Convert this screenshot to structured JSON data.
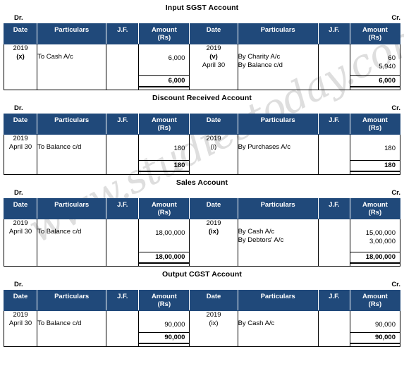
{
  "watermark": {
    "text": "www.studiestoday.com"
  },
  "labels": {
    "dr": "Dr.",
    "cr": "Cr.",
    "col_date": "Date",
    "col_particulars": "Particulars",
    "col_jf": "J.F.",
    "col_amount_line1": "Amount",
    "col_amount_line2": "(Rs)"
  },
  "colors": {
    "header_bg": "#20497a",
    "header_text": "#ffffff",
    "border": "#000000",
    "watermark": "#d9d9d9"
  },
  "accounts": [
    {
      "title": "Input SGST Account",
      "debit": {
        "date_lines": [
          "2019",
          "(x)"
        ],
        "date_bold": [
          false,
          true
        ],
        "particulars": [
          "To Cash A/c"
        ],
        "jf": "",
        "amounts": [
          "6,000"
        ],
        "total": "6,000"
      },
      "credit": {
        "date_lines": [
          "2019",
          "(v)",
          "April 30"
        ],
        "date_bold": [
          false,
          true,
          false
        ],
        "particulars": [
          "By Charity A/c",
          "By Balance c/d"
        ],
        "jf": "",
        "amounts": [
          "60",
          "5,940"
        ],
        "total": "6,000"
      }
    },
    {
      "title": "Discount Received  Account",
      "debit": {
        "date_lines": [
          "2019",
          "April 30"
        ],
        "date_bold": [
          false,
          false
        ],
        "particulars": [
          "To Balance c/d"
        ],
        "jf": "",
        "amounts": [
          "180"
        ],
        "total": "180"
      },
      "credit": {
        "date_lines": [
          "2019",
          "(i)"
        ],
        "date_bold": [
          false,
          false
        ],
        "particulars": [
          "By Purchases A/c"
        ],
        "jf": "",
        "amounts": [
          "180"
        ],
        "total": "180"
      }
    },
    {
      "title": "Sales Account",
      "debit": {
        "date_lines": [
          "2019",
          "April 30"
        ],
        "date_bold": [
          false,
          false
        ],
        "particulars": [
          "To Balance c/d"
        ],
        "jf": "",
        "amounts": [
          "18,00,000"
        ],
        "total": "18,00,000"
      },
      "credit": {
        "date_lines": [
          "2019",
          "(ix)"
        ],
        "date_bold": [
          false,
          true
        ],
        "particulars": [
          "By Cash A/c",
          "By Debtors' A/c"
        ],
        "jf": "",
        "amounts": [
          "15,00,000",
          "3,00,000"
        ],
        "total": "18,00,000"
      }
    },
    {
      "title": "Output CGST Account",
      "debit": {
        "date_lines": [
          "2019",
          "April 30"
        ],
        "date_bold": [
          false,
          false
        ],
        "particulars": [
          "To Balance c/d"
        ],
        "jf": "",
        "amounts": [
          "90,000"
        ],
        "total": "90,000"
      },
      "credit": {
        "date_lines": [
          "2019",
          "(ix)"
        ],
        "date_bold": [
          false,
          false
        ],
        "particulars": [
          "By Cash A/c"
        ],
        "jf": "",
        "amounts": [
          "90,000"
        ],
        "total": "90,000"
      }
    }
  ]
}
